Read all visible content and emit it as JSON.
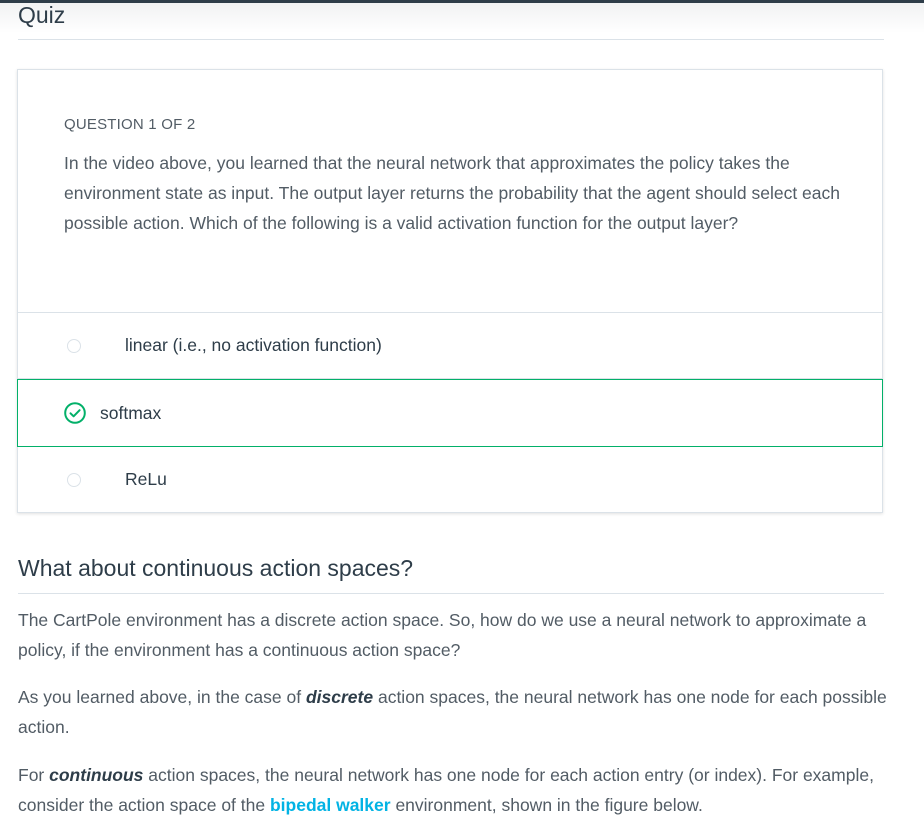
{
  "quiz": {
    "title": "Quiz",
    "counter": "QUESTION 1 OF 2",
    "question": "In the video above, you learned that the neural network that approximates the policy takes the environment state as input. The output layer returns the probability that the agent should select each possible action. Which of the following is a valid activation function for the output layer?",
    "options": [
      {
        "label": "linear (i.e., no activation function)",
        "selected": false
      },
      {
        "label": "softmax",
        "selected": true,
        "correct": true
      },
      {
        "label": "ReLu",
        "selected": false
      }
    ]
  },
  "article": {
    "heading": "What about continuous action spaces?",
    "p1": "The CartPole environment has a discrete action space. So, how do we use a neural network to approximate a policy, if the environment has a continuous action space?",
    "p2_before": "As you learned above, in the case of ",
    "p2_em": "discrete",
    "p2_after": " action spaces, the neural network has one node for each possible action.",
    "p3_before": "For ",
    "p3_em": "continuous",
    "p3_mid": " action spaces, the neural network has one node for each action entry (or index). For example, consider the action space of the ",
    "p3_link": "bipedal walker",
    "p3_after": " environment, shown in the figure below."
  },
  "colors": {
    "correct": "#02b069",
    "link": "#02b3e4",
    "text": "#525c65",
    "heading": "#2e3d49"
  }
}
